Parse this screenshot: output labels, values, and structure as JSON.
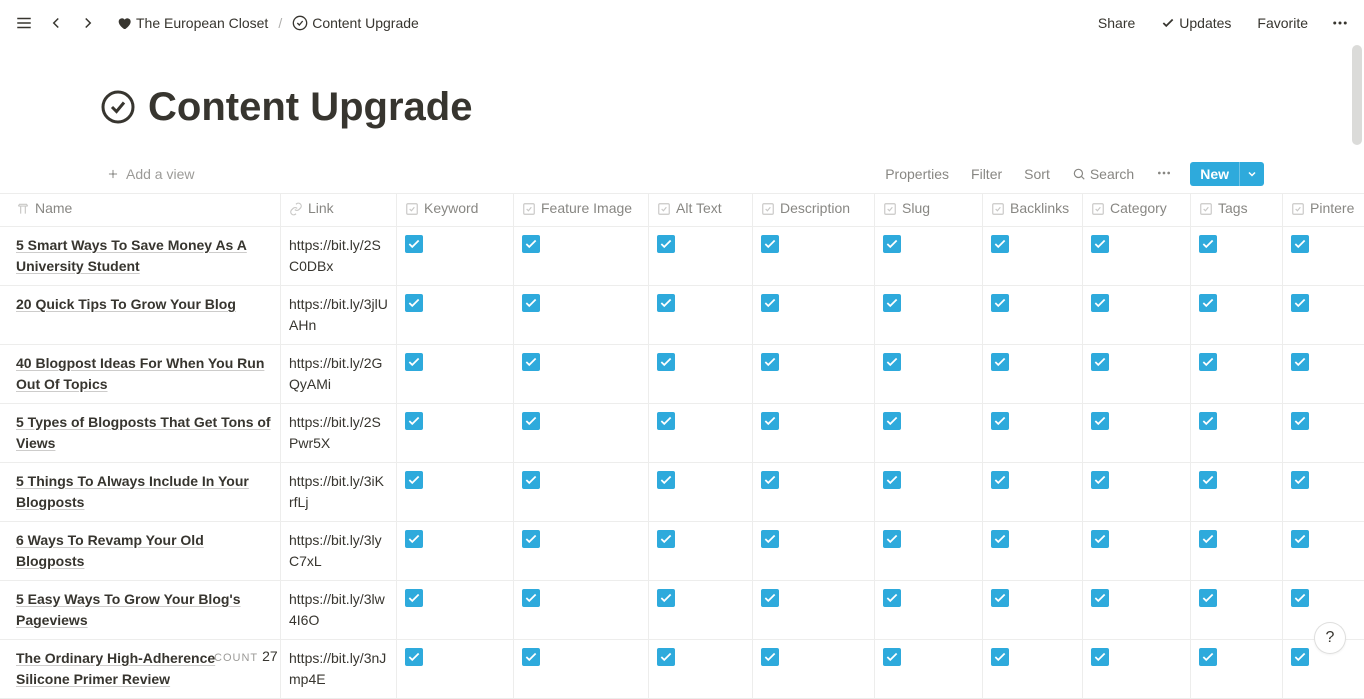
{
  "topbar": {
    "breadcrumb_parent": "The European Closet",
    "breadcrumb_current": "Content Upgrade",
    "share": "Share",
    "updates": "Updates",
    "favorite": "Favorite"
  },
  "page": {
    "title": "Content Upgrade"
  },
  "db_toolbar": {
    "add_view": "Add a view",
    "properties": "Properties",
    "filter": "Filter",
    "sort": "Sort",
    "search": "Search",
    "new": "New"
  },
  "columns": {
    "name": "Name",
    "link": "Link",
    "keyword": "Keyword",
    "feature_image": "Feature Image",
    "alt_text": "Alt Text",
    "description": "Description",
    "slug": "Slug",
    "backlinks": "Backlinks",
    "category": "Category",
    "tags": "Tags",
    "pinterest": "Pintere"
  },
  "rows": [
    {
      "name": "5 Smart Ways To Save Money As A University Student",
      "link": "https://bit.ly/2SC0DBx",
      "keyword": true,
      "feature_image": true,
      "alt_text": true,
      "description": true,
      "slug": true,
      "backlinks": true,
      "category": true,
      "tags": true,
      "pinterest": true
    },
    {
      "name": "20 Quick Tips To Grow Your Blog",
      "link": "https://bit.ly/3jlUAHn",
      "keyword": true,
      "feature_image": true,
      "alt_text": true,
      "description": true,
      "slug": true,
      "backlinks": true,
      "category": true,
      "tags": true,
      "pinterest": true
    },
    {
      "name": "40 Blogpost Ideas For When You Run Out Of Topics",
      "link": "https://bit.ly/2GQyAMi",
      "keyword": true,
      "feature_image": true,
      "alt_text": true,
      "description": true,
      "slug": true,
      "backlinks": true,
      "category": true,
      "tags": true,
      "pinterest": true
    },
    {
      "name": "5 Types of Blogposts That Get Tons of Views",
      "link": "https://bit.ly/2SPwr5X",
      "keyword": true,
      "feature_image": true,
      "alt_text": true,
      "description": true,
      "slug": true,
      "backlinks": true,
      "category": true,
      "tags": true,
      "pinterest": true
    },
    {
      "name": "5 Things To Always Include In Your Blogposts",
      "link": "https://bit.ly/3iKrfLj",
      "keyword": true,
      "feature_image": true,
      "alt_text": true,
      "description": true,
      "slug": true,
      "backlinks": true,
      "category": true,
      "tags": true,
      "pinterest": true
    },
    {
      "name": "6 Ways To Revamp Your Old Blogposts",
      "link": "https://bit.ly/3lyC7xL",
      "keyword": true,
      "feature_image": true,
      "alt_text": true,
      "description": true,
      "slug": true,
      "backlinks": true,
      "category": true,
      "tags": true,
      "pinterest": true
    },
    {
      "name": "5 Easy Ways To Grow Your Blog's Pageviews",
      "link": "https://bit.ly/3lw4I6O",
      "keyword": true,
      "feature_image": true,
      "alt_text": true,
      "description": true,
      "slug": true,
      "backlinks": true,
      "category": true,
      "tags": true,
      "pinterest": true
    },
    {
      "name": "The Ordinary High-Adherence Silicone Primer Review",
      "link": "https://bit.ly/3nJmp4E",
      "keyword": true,
      "feature_image": true,
      "alt_text": true,
      "description": true,
      "slug": true,
      "backlinks": true,
      "category": true,
      "tags": true,
      "pinterest": true
    }
  ],
  "footer": {
    "count_label": "COUNT",
    "count_value": "27"
  }
}
